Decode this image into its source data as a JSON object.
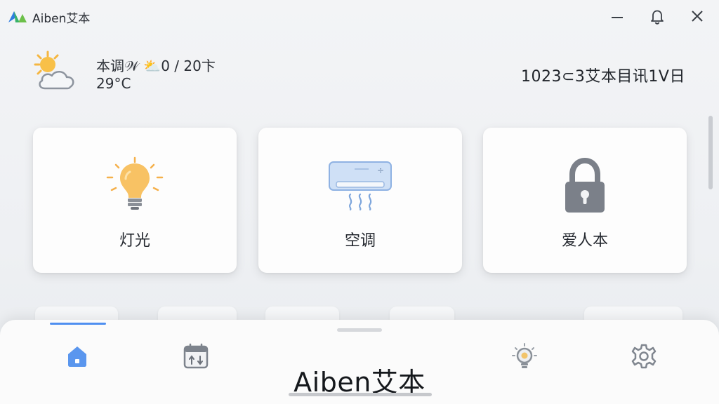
{
  "app": {
    "title": "Aiben艾本"
  },
  "weather": {
    "line1": "本调𝒲 ⛅0 / 20卞",
    "temperature": "29°C",
    "icon": "partly-cloudy-icon"
  },
  "date": {
    "text": "1023⊂3艾本目讯1V日"
  },
  "devices": [
    {
      "label": "灯光",
      "icon": "light-bulb-icon"
    },
    {
      "label": "空调",
      "icon": "air-conditioner-icon"
    },
    {
      "label": "爱人本",
      "icon": "lock-icon"
    }
  ],
  "bottom_nav": {
    "title": "Aiben艾本",
    "items": [
      {
        "icon": "home-icon",
        "active": true
      },
      {
        "icon": "calendar-icon",
        "active": false
      },
      {
        "icon": "bulb-icon",
        "active": false
      },
      {
        "icon": "gear-icon",
        "active": false
      }
    ]
  },
  "colors": {
    "accent": "#4f8ff0",
    "bulb": "#f6bd5e",
    "lock": "#7b8089",
    "ac": "#a9c6ef"
  }
}
